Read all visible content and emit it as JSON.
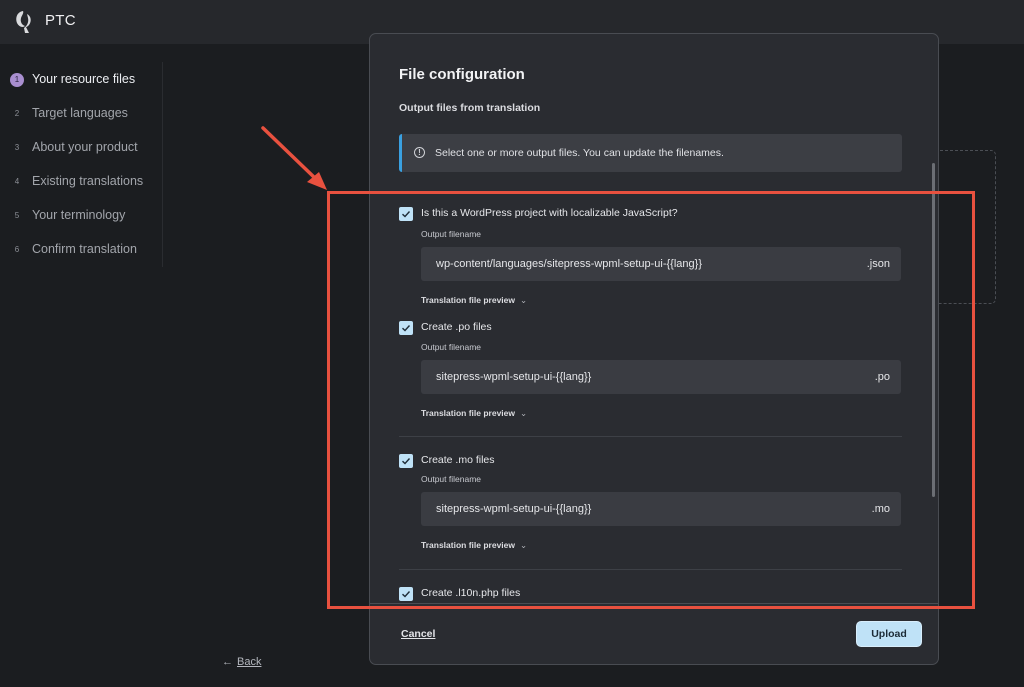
{
  "app": {
    "name": "PTC"
  },
  "steps": [
    {
      "num": "1",
      "label": "Your resource files",
      "active": true
    },
    {
      "num": "2",
      "label": "Target languages",
      "active": false
    },
    {
      "num": "3",
      "label": "About your product",
      "active": false
    },
    {
      "num": "4",
      "label": "Existing translations",
      "active": false
    },
    {
      "num": "5",
      "label": "Your terminology",
      "active": false
    },
    {
      "num": "6",
      "label": "Confirm translation",
      "active": false
    }
  ],
  "back": {
    "arrow": "←",
    "label": "Back"
  },
  "modal": {
    "title": "File configuration",
    "subtitle": "Output files from translation",
    "info": {
      "icon": "!",
      "text": "Select one or more output files. You can update the filenames."
    },
    "options": [
      {
        "label": "Is this a WordPress project with localizable JavaScript?",
        "checked": true,
        "field_label": "Output filename",
        "filename": "wp-content/languages/sitepress-wpml-setup-ui-{{lang}}",
        "ext": ".json",
        "preview": "Translation file preview"
      },
      {
        "label": "Create .po files",
        "checked": true,
        "field_label": "Output filename",
        "filename": "sitepress-wpml-setup-ui-{{lang}}",
        "ext": ".po",
        "preview": "Translation file preview"
      },
      {
        "label": "Create .mo files",
        "checked": true,
        "field_label": "Output filename",
        "filename": "sitepress-wpml-setup-ui-{{lang}}",
        "ext": ".mo",
        "preview": "Translation file preview"
      },
      {
        "label": "Create .l10n.php files",
        "checked": true
      }
    ],
    "cancel_label": "Cancel",
    "upload_label": "Upload"
  },
  "annotation": {
    "color": "#e8513f"
  }
}
